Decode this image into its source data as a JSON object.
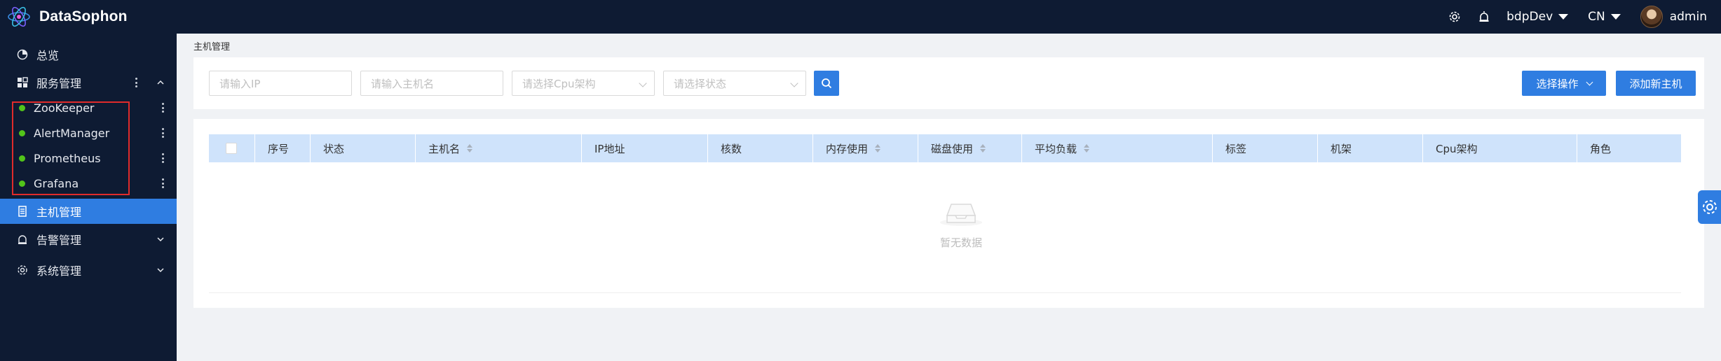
{
  "app": {
    "name": "DataSophon"
  },
  "header": {
    "cluster": "bdpDev",
    "language": "CN",
    "user": "admin"
  },
  "sidebar": {
    "items": [
      {
        "label": "总览"
      },
      {
        "label": "服务管理"
      },
      {
        "label": "主机管理"
      },
      {
        "label": "告警管理"
      },
      {
        "label": "系统管理"
      }
    ],
    "services": [
      {
        "label": "ZooKeeper",
        "status_color": "#52c41a"
      },
      {
        "label": "AlertManager",
        "status_color": "#52c41a"
      },
      {
        "label": "Prometheus",
        "status_color": "#52c41a"
      },
      {
        "label": "Grafana",
        "status_color": "#52c41a"
      }
    ]
  },
  "breadcrumb": "主机管理",
  "filters": {
    "ip_placeholder": "请输入IP",
    "hostname_placeholder": "请输入主机名",
    "cpu_placeholder": "请选择Cpu架构",
    "status_placeholder": "请选择状态"
  },
  "actions": {
    "select_op": "选择操作",
    "add_host": "添加新主机"
  },
  "table": {
    "columns": [
      "序号",
      "状态",
      "主机名",
      "IP地址",
      "核数",
      "内存使用",
      "磁盘使用",
      "平均负载",
      "标签",
      "机架",
      "Cpu架构",
      "角色"
    ],
    "empty_text": "暂无数据"
  },
  "colors": {
    "primary": "#2f7de1",
    "header_bg": "#0e1b33",
    "table_header_bg": "#cfe3fb",
    "running": "#52c41a",
    "highlight": "#e02b2b"
  }
}
